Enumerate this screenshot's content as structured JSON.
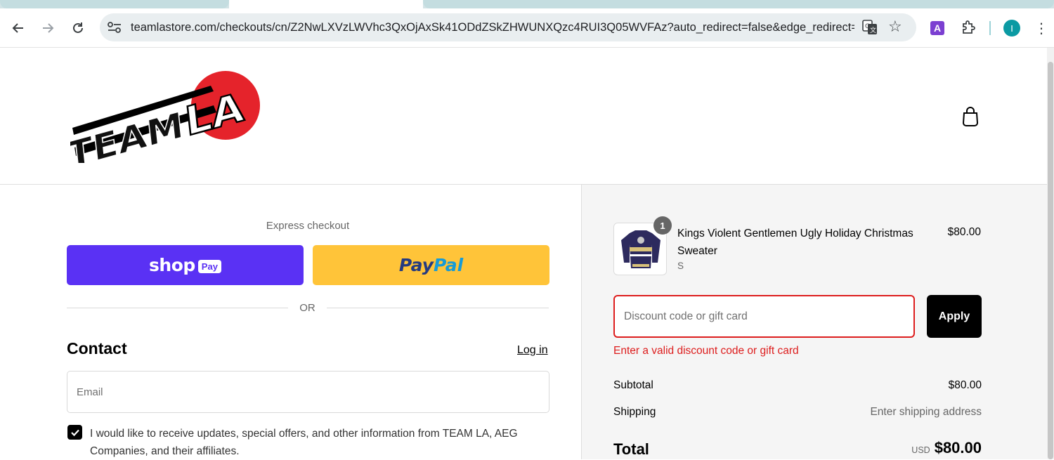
{
  "browser": {
    "url": "teamlastore.com/checkouts/cn/Z2NwLXVzLWVhc3QxOjAxSk41ODdZSkZHWUNXQzc4RUI3Q05WVFAz?auto_redirect=false&edge_redirect=t...",
    "profile_initial": "I",
    "extension_label": "A"
  },
  "brand": {
    "logo_text_left": "TEAM",
    "logo_text_right": "LA"
  },
  "express": {
    "label": "Express checkout",
    "shop_word": "shop",
    "shop_badge": "Pay",
    "paypal_part1": "Pay",
    "paypal_part2": "Pal",
    "or_label": "OR"
  },
  "contact": {
    "title": "Contact",
    "login_link": "Log in",
    "email_placeholder": "Email",
    "marketing_opt_in": "I would like to receive updates, special offers, and other information from TEAM LA, AEG Companies, and their affiliates.",
    "marketing_checked": true
  },
  "order": {
    "item": {
      "quantity": "1",
      "name": "Kings Violent Gentlemen Ugly Holiday Christmas Sweater",
      "variant": "S",
      "price": "$80.00"
    },
    "discount": {
      "placeholder": "Discount code or gift card",
      "apply_label": "Apply",
      "error": "Enter a valid discount code or gift card"
    },
    "subtotal_label": "Subtotal",
    "subtotal_value": "$80.00",
    "shipping_label": "Shipping",
    "shipping_value": "Enter shipping address",
    "total_label": "Total",
    "total_currency": "USD",
    "total_value": "$80.00"
  },
  "colors": {
    "shop_pay": "#5a31f4",
    "paypal": "#ffc439",
    "error": "#dd1d1d",
    "logo_red": "#e5232b"
  }
}
